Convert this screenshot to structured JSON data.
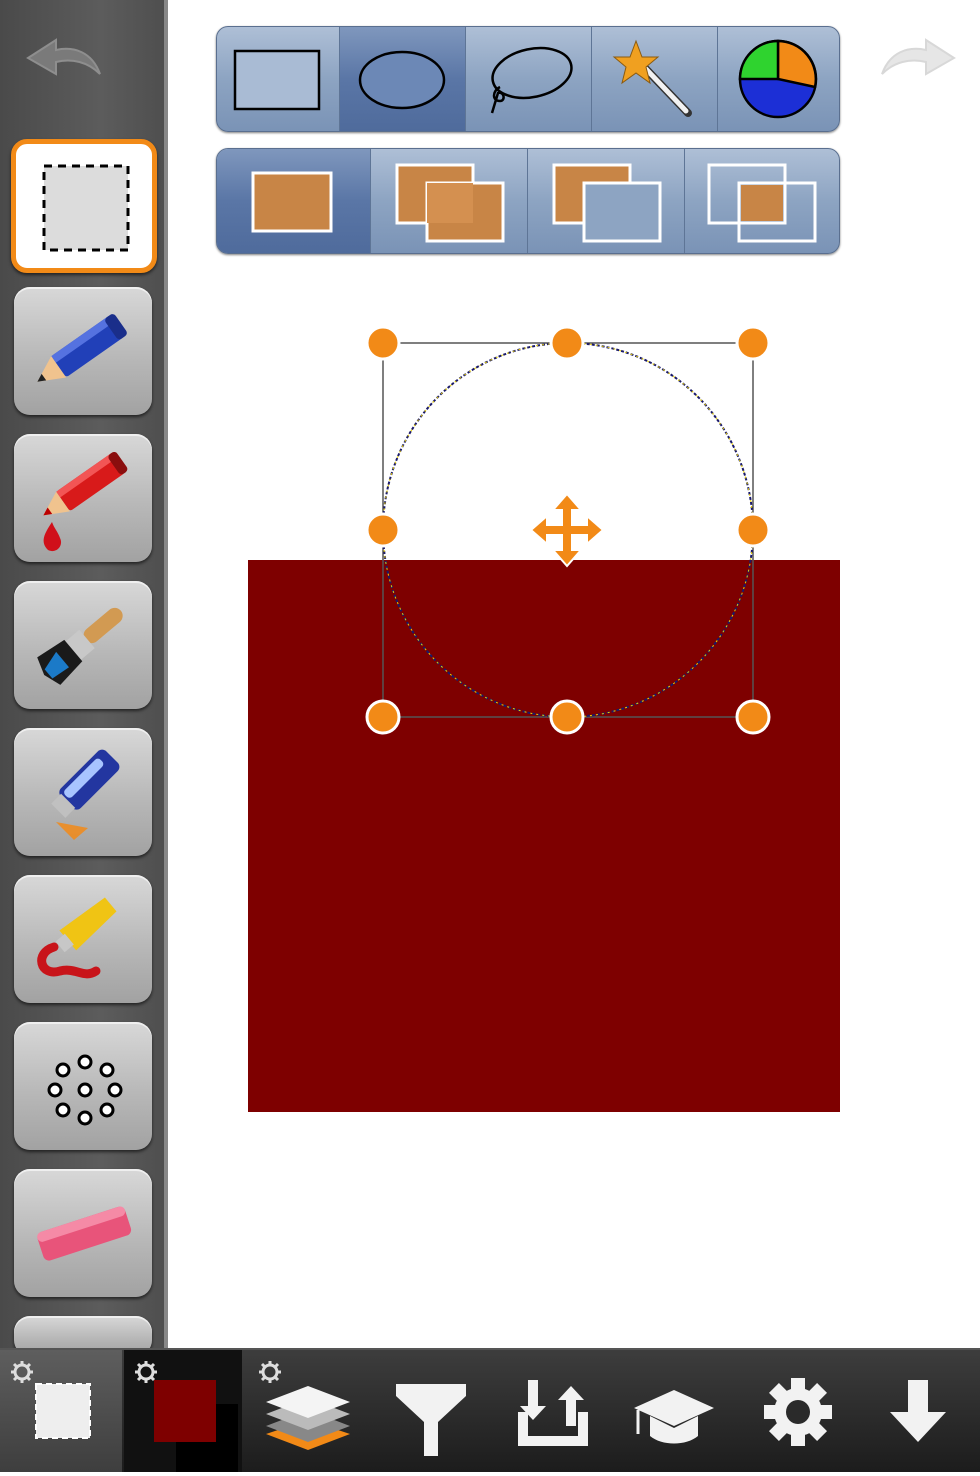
{
  "colors": {
    "accent": "#f28a17",
    "fill_color": "#7e0000",
    "toolbar_blue": "#8da4c2",
    "handle": "#f28a17"
  },
  "left_toolbar": {
    "undo_icon": "undo-arrow-icon",
    "tools": [
      {
        "name": "selection-tool",
        "icon": "dashed-square-icon",
        "selected": true
      },
      {
        "name": "pencil-tool",
        "icon": "pencil-icon"
      },
      {
        "name": "ink-pen-tool",
        "icon": "red-pencil-drop-icon"
      },
      {
        "name": "brush-tool",
        "icon": "paintbrush-icon"
      },
      {
        "name": "airbrush-tool",
        "icon": "spray-marker-icon"
      },
      {
        "name": "paint-tube-tool",
        "icon": "paint-tube-icon"
      },
      {
        "name": "dots-tool",
        "icon": "dot-ring-icon"
      },
      {
        "name": "eraser-tool",
        "icon": "eraser-icon"
      }
    ]
  },
  "selection_shape_toolbar": {
    "options": [
      "rectangle",
      "ellipse",
      "lasso",
      "magic-wand",
      "color-select"
    ],
    "active": "ellipse"
  },
  "selection_mode_toolbar": {
    "options": [
      "new",
      "add",
      "subtract",
      "intersect"
    ],
    "active": "new"
  },
  "redo_icon": "redo-arrow-icon",
  "bottom_toolbar": {
    "items": [
      "selection-settings",
      "color-swatch",
      "layers",
      "filters",
      "import-export",
      "tutorials",
      "settings",
      "save-download"
    ],
    "current_color": "#7e0000"
  }
}
